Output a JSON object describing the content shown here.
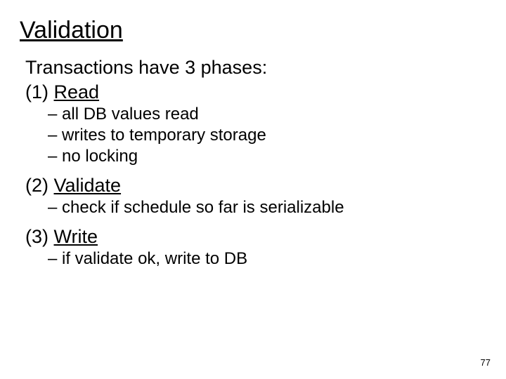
{
  "title": "Validation",
  "intro": "Transactions have 3 phases:",
  "phases": {
    "p1": {
      "num": "(1) ",
      "name": "Read",
      "items": {
        "a": "– all DB values read",
        "b": "– writes to temporary storage",
        "c": "– no locking"
      }
    },
    "p2": {
      "num": "(2) ",
      "name": "Validate",
      "items": {
        "a": "– check if schedule so far is serializable"
      }
    },
    "p3": {
      "num": "(3) ",
      "name": "Write",
      "items": {
        "a": "– if validate ok, write to DB"
      }
    }
  },
  "page_number": "77"
}
